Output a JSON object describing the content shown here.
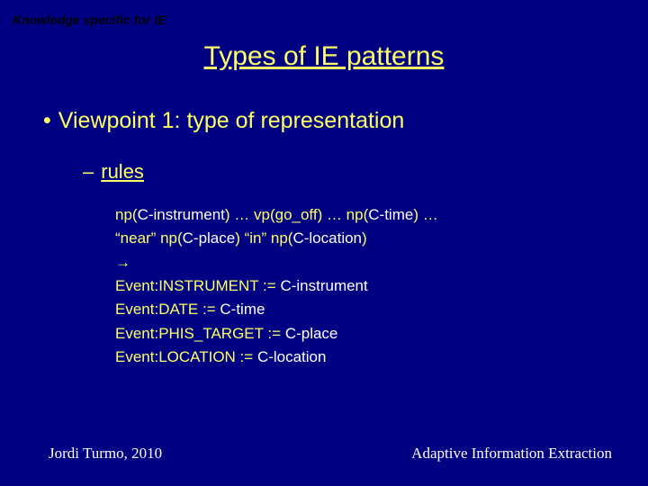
{
  "header": {
    "label": "Knowledge specific for IE"
  },
  "title": "Types of IE patterns",
  "bullet1": {
    "dot": "•",
    "text": "Viewpoint 1: type of representation"
  },
  "bullet2": {
    "dash": "–",
    "text": "rules"
  },
  "rule": {
    "l1a": "np(",
    "l1b": "C-instrument",
    "l1c": ") … vp(go_off) … np(",
    "l1d": "C-time",
    "l1e": ") …",
    "l2a": "“near” np(",
    "l2b": "C-place",
    "l2c": ") “in” np(",
    "l2d": "C-location",
    "l2e": ")",
    "l3": "→",
    "l4a": "Event:INSTRUMENT := ",
    "l4b": "C-instrument",
    "l5a": "Event:DATE := ",
    "l5b": "C-time",
    "l6a": "Event:PHIS_TARGET := ",
    "l6b": "C-place",
    "l7a": "Event:LOCATION := ",
    "l7b": "C-location"
  },
  "footer": {
    "left": "Jordi Turmo, 2010",
    "right": "Adaptive Information Extraction"
  }
}
